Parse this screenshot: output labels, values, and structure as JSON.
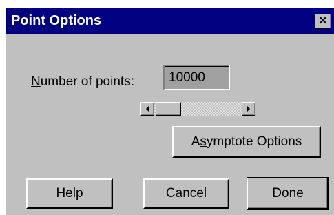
{
  "window": {
    "title": "Point Options",
    "close_glyph": "✕"
  },
  "points": {
    "label_accel": "N",
    "label_rest": "umber of points:",
    "value": "10000"
  },
  "scrollbar": {
    "left_icon": "arrow-left-icon",
    "right_icon": "arrow-right-icon"
  },
  "buttons": {
    "asymptote_pre": "A",
    "asymptote_accel": "s",
    "asymptote_post": "ymptote Options",
    "help": "Help",
    "cancel": "Cancel",
    "done": "Done"
  },
  "colors": {
    "titlebar": "#000080",
    "dialog_bg": "#c0c0c0",
    "field_bg": "#a0a0a0"
  }
}
